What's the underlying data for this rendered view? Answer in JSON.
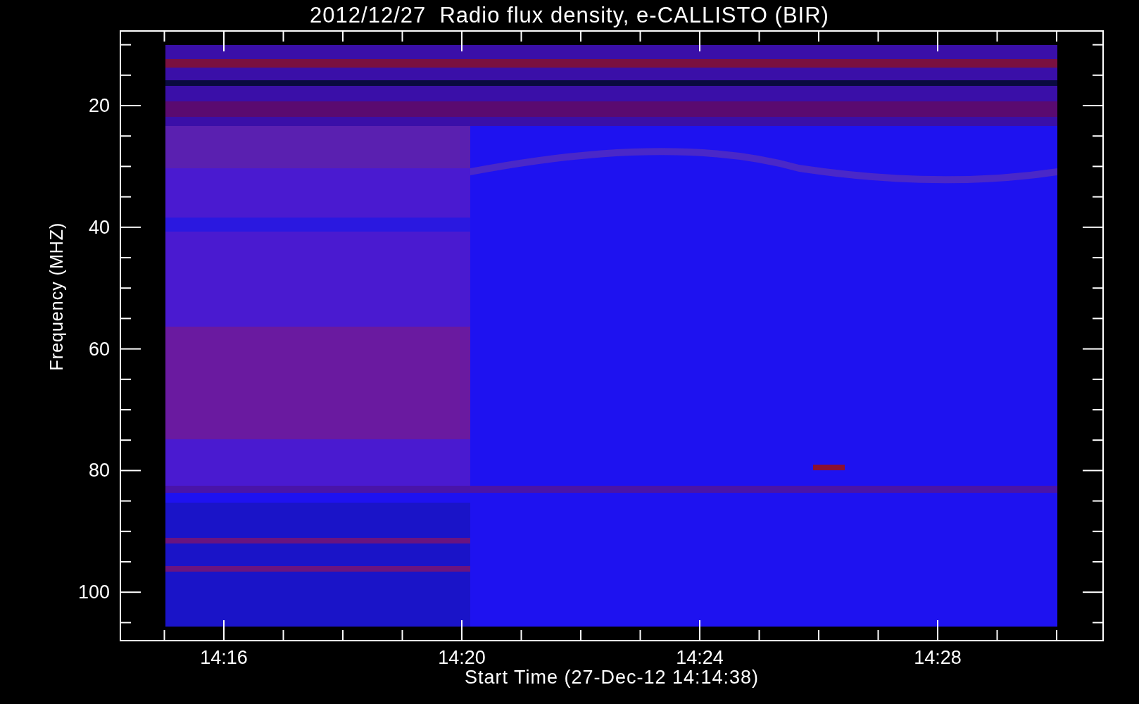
{
  "title": "2012/12/27  Radio flux density, e-CALLISTO (BIR)",
  "y_axis": {
    "label": "Frequency (MHZ)",
    "ticks": [
      "20",
      "40",
      "60",
      "80",
      "100"
    ]
  },
  "x_axis": {
    "label": "Start Time (27-Dec-12 14:14:38)",
    "ticks": [
      "14:16",
      "14:20",
      "14:24",
      "14:28"
    ]
  }
}
